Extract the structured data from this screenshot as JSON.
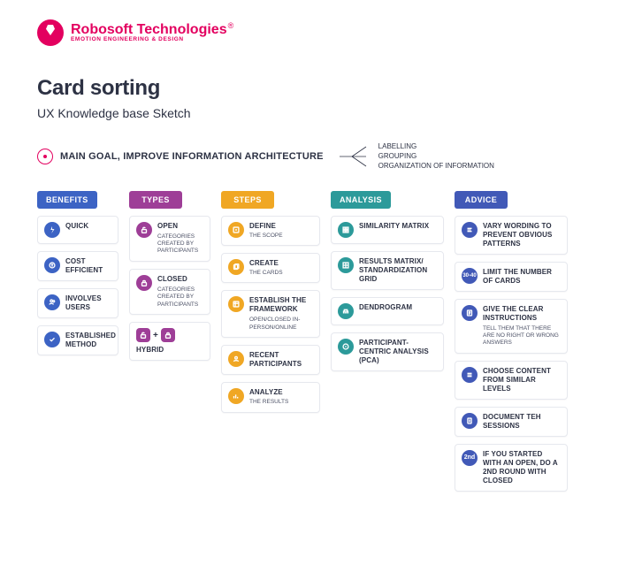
{
  "logo": {
    "title": "Robosoft Technologies",
    "reg": "®",
    "sub": "EMOTION ENGINEERING & DESIGN"
  },
  "page_title": "Card sorting",
  "subtitle": "UX Knowledge base Sketch",
  "goal": {
    "text": "MAIN GOAL, IMPROVE INFORMATION ARCHITECTURE",
    "items": [
      "LABELLING",
      "GROUPING",
      "ORGANIZATION OF INFORMATION"
    ]
  },
  "columns": {
    "benefits": {
      "label": "BENEFITS",
      "items": [
        {
          "title": "QUICK"
        },
        {
          "title": "COST EFFICIENT"
        },
        {
          "title": "INVOLVES USERS"
        },
        {
          "title": "ESTABLISHED METHOD"
        }
      ]
    },
    "types": {
      "label": "TYPES",
      "items": [
        {
          "title": "OPEN",
          "sub": "CATEGORIES CREATED BY PARTICIPANTS"
        },
        {
          "title": "CLOSED",
          "sub": "CATEGORIES CREATED BY PARTICIPANTS"
        },
        {
          "title": "HYBRID"
        }
      ]
    },
    "steps": {
      "label": "STEPS",
      "items": [
        {
          "title": "DEFINE",
          "sub": "THE SCOPE"
        },
        {
          "title": "CREATE",
          "sub": "THE CARDS"
        },
        {
          "title": "ESTABLISH THE FRAMEWORK",
          "sub": "OPEN/CLOSED IN-PERSON/ONLINE"
        },
        {
          "title": "RECENT PARTICIPANTS"
        },
        {
          "title": "ANALYZE",
          "sub": "THE RESULTS"
        }
      ]
    },
    "analysis": {
      "label": "ANALYSIS",
      "items": [
        {
          "title": "SIMILARITY MATRIX"
        },
        {
          "title": "RESULTS MATRIX/ STANDARDIZATION GRID"
        },
        {
          "title": "DENDROGRAM"
        },
        {
          "title": "PARTICIPANT-CENTRIC ANALYSIS (PCA)"
        }
      ]
    },
    "advice": {
      "label": "ADVICE",
      "items": [
        {
          "title": "VARY WORDING TO PREVENT OBVIOUS PATTERNS"
        },
        {
          "title": "LIMIT THE NUMBER OF CARDS"
        },
        {
          "title": "GIVE THE CLEAR INSTRUCTIONS",
          "sub": "TELL THEM THAT THERE ARE NO RIGHT OR WRONG ANSWERS"
        },
        {
          "title": "CHOOSE CONTENT FROM SIMILAR LEVELS"
        },
        {
          "title": "DOCUMENT TEH SESSIONS"
        },
        {
          "title": "IF YOU STARTED WITH AN OPEN, DO A 2ND ROUND WITH CLOSED"
        }
      ]
    }
  }
}
